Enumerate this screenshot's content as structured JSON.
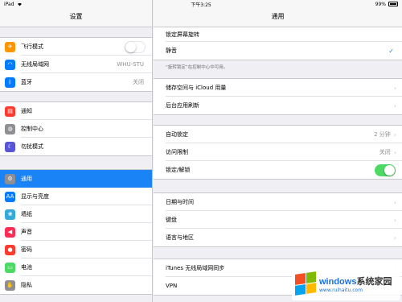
{
  "status_bar": {
    "device": "iPad",
    "time": "下午3:25",
    "battery": "99%"
  },
  "sidebar": {
    "title": "设置",
    "groups": [
      [
        {
          "label": "飞行模式",
          "icon": "airplane-icon",
          "color": "#ff9500",
          "toggle": false
        },
        {
          "label": "无线局域网",
          "icon": "wifi-icon",
          "color": "#007aff",
          "value": "WHU-STU"
        },
        {
          "label": "蓝牙",
          "icon": "bluetooth-icon",
          "color": "#007aff",
          "value": "关闭"
        }
      ],
      [
        {
          "label": "通知",
          "icon": "notifications-icon",
          "color": "#ff3b30"
        },
        {
          "label": "控制中心",
          "icon": "control-center-icon",
          "color": "#8e8e93"
        },
        {
          "label": "勿扰模式",
          "icon": "moon-icon",
          "color": "#5856d6"
        }
      ],
      [
        {
          "label": "通用",
          "icon": "gear-icon",
          "color": "#8e8e93",
          "selected": true
        },
        {
          "label": "显示与亮度",
          "icon": "display-icon",
          "color": "#007aff"
        },
        {
          "label": "墙纸",
          "icon": "wallpaper-icon",
          "color": "#34aadc"
        },
        {
          "label": "声音",
          "icon": "sound-icon",
          "color": "#ff2d55"
        },
        {
          "label": "密码",
          "icon": "passcode-icon",
          "color": "#ff3b30"
        },
        {
          "label": "电池",
          "icon": "battery-icon",
          "color": "#4cd964"
        },
        {
          "label": "隐私",
          "icon": "privacy-hand-icon",
          "color": "#8e8e93"
        }
      ]
    ]
  },
  "main": {
    "title": "通用",
    "section1": {
      "header": "锁定屏幕旋转",
      "selected": "静音",
      "footnote": "“旋转锁定”在控制中心中可用。"
    },
    "section2": [
      "储存空间与 iCloud 用量",
      "后台应用刷新"
    ],
    "section3": [
      {
        "label": "自动锁定",
        "value": "2 分钟"
      },
      {
        "label": "访问限制",
        "value": "关闭"
      },
      {
        "label": "锁定/解锁",
        "toggle": true
      }
    ],
    "section4": [
      "日期与时间",
      "键盘",
      "语言与地区"
    ],
    "section5": [
      "iTunes 无线局域网同步",
      "VPN"
    ]
  },
  "watermark": {
    "brand": "windows",
    "brand_suffix": "系统家园",
    "url": "www.ruihaitu.com"
  }
}
